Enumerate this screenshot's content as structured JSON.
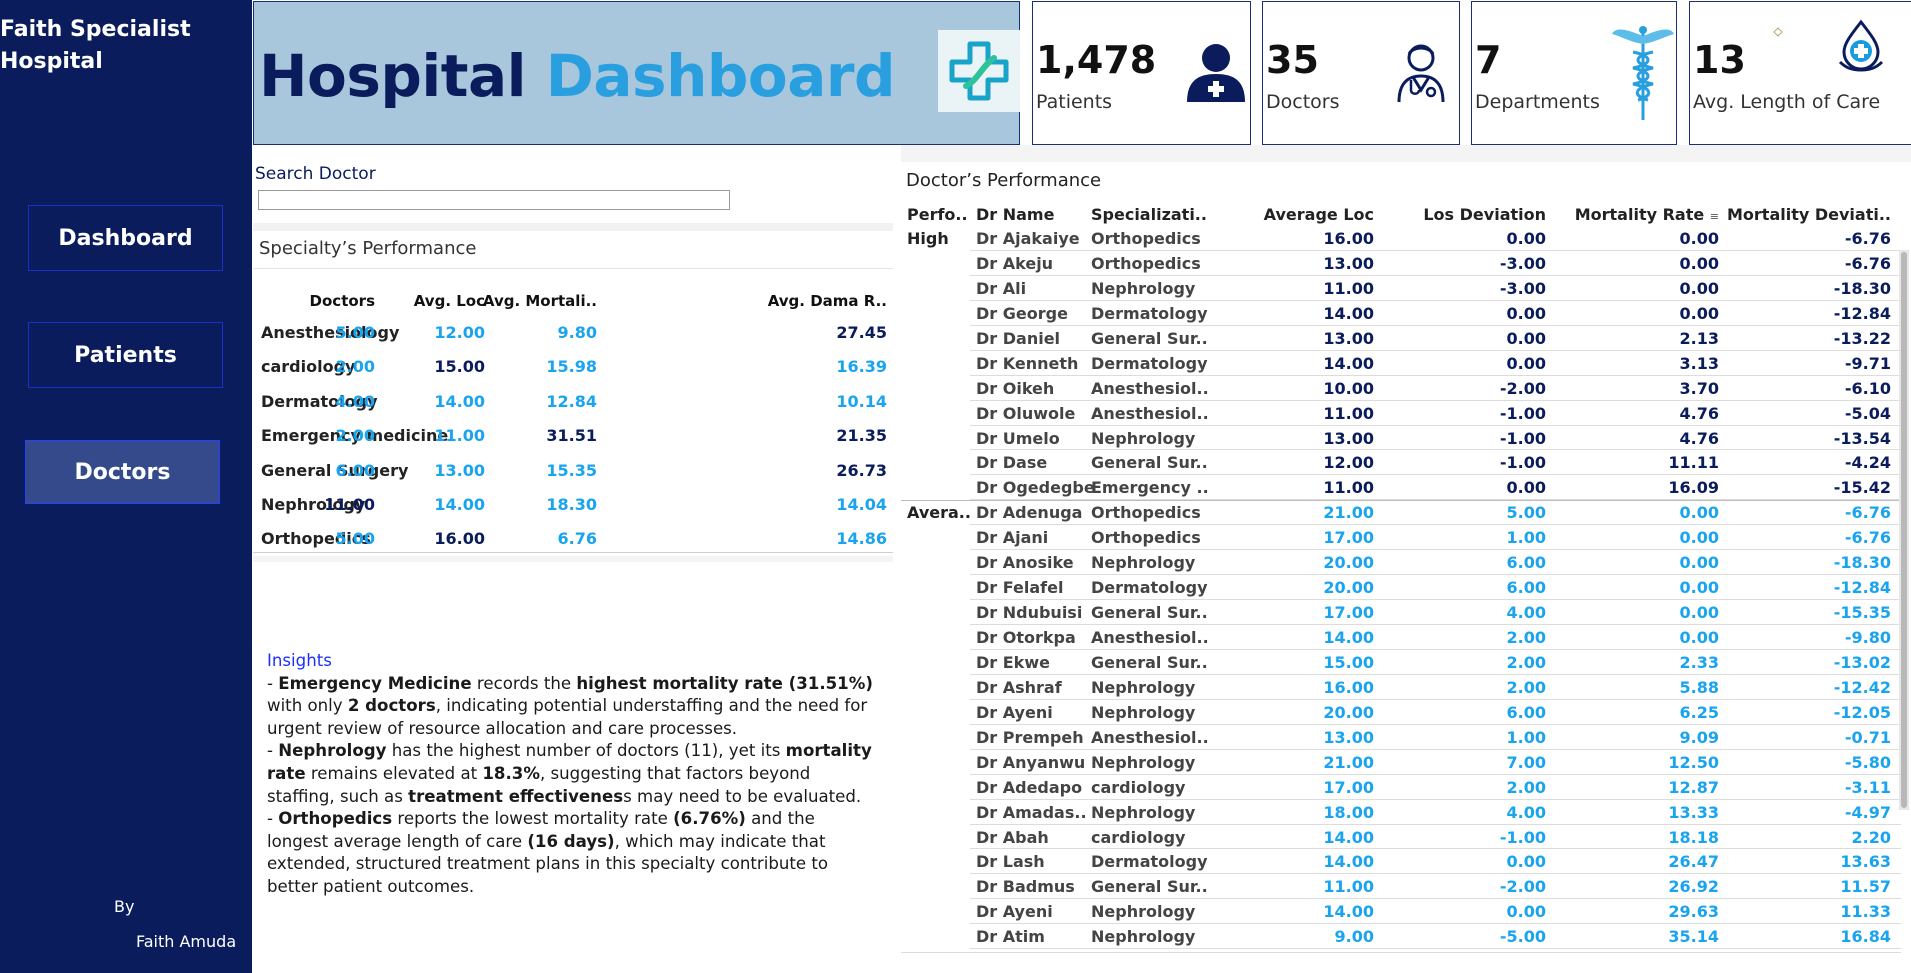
{
  "sidebar": {
    "hospital_name_line1": "Faith Specialist",
    "hospital_name_line2": "Hospital",
    "nav": {
      "dashboard": "Dashboard",
      "patients": "Patients",
      "doctors": "Doctors"
    },
    "by_label": "By",
    "author": "Faith Amuda"
  },
  "header": {
    "title_word1": "Hospital",
    "title_word2": "Dashboard"
  },
  "kpis": {
    "patients": {
      "value": "1,478",
      "label": "Patients"
    },
    "doctors": {
      "value": "35",
      "label": "Doctors"
    },
    "departments": {
      "value": "7",
      "label": "Departments"
    },
    "avg_care": {
      "value": "13",
      "label": "Avg. Length of Care"
    }
  },
  "search": {
    "label": "Search Doctor",
    "value": ""
  },
  "specialty": {
    "title": "Specialty’s Performance",
    "headers": {
      "doctors": "Doctors",
      "avg_loc": "Avg. Loc",
      "avg_mort": "Avg. Mortali..",
      "avg_dama": "Avg. Dama R.."
    },
    "rows": [
      {
        "name": "Anesthesiology",
        "doctors": "5.00",
        "avg_loc": "12.00",
        "avg_mort": "9.80",
        "avg_dama": "27.45"
      },
      {
        "name": "cardiology",
        "doctors": "2.00",
        "avg_loc": "15.00",
        "avg_mort": "15.98",
        "avg_dama": "16.39"
      },
      {
        "name": "Dermatology",
        "doctors": "4.00",
        "avg_loc": "14.00",
        "avg_mort": "12.84",
        "avg_dama": "10.14"
      },
      {
        "name": "Emergency medicine",
        "doctors": "2.00",
        "avg_loc": "11.00",
        "avg_mort": "31.51",
        "avg_dama": "21.35"
      },
      {
        "name": "General Surgery",
        "doctors": "6.00",
        "avg_loc": "13.00",
        "avg_mort": "15.35",
        "avg_dama": "26.73"
      },
      {
        "name": "Nephrology",
        "doctors": "11.00",
        "avg_loc": "14.00",
        "avg_mort": "18.30",
        "avg_dama": "14.04"
      },
      {
        "name": "Orthopedics",
        "doctors": "5.00",
        "avg_loc": "16.00",
        "avg_mort": "6.76",
        "avg_dama": "14.86"
      }
    ]
  },
  "insights": {
    "title": "Insights",
    "p1": [
      "- ",
      "Emergency Medicine",
      " records the ",
      "highest mortality rate (31.51%)",
      " with only ",
      "2 doctors",
      ", indicating potential understaffing and the need for urgent review of resource allocation and care processes."
    ],
    "p2": [
      "- ",
      "Nephrology",
      " has the highest number of doctors (11), yet its ",
      "mortality rate",
      " remains elevated at ",
      "18.3%",
      ", suggesting that factors beyond staffing, such as ",
      "treatment effectivenes",
      "s may need to be evaluated."
    ],
    "p3": [
      "- ",
      "Orthopedics",
      " reports the lowest mortality rate ",
      "(6.76%)",
      " and the longest average length of care ",
      "(16 days)",
      ", which may indicate that extended, structured treatment plans in this specialty contribute to better patient outcomes."
    ]
  },
  "doctors_table": {
    "title": "Doctor’s Performance",
    "headers": {
      "perf": "Perfo..",
      "name": "Dr Name",
      "spec": "Specializati..",
      "loc": "Average Loc",
      "dev": "Los Deviation",
      "mort": "Mortality Rate",
      "mdev": "Mortality Deviati.."
    },
    "groups": [
      {
        "label": "High",
        "rows": [
          {
            "name": "Dr Ajakaiye",
            "spec": "Orthopedics",
            "loc": "16.00",
            "dev": "0.00",
            "mort": "0.00",
            "mdev": "-6.76"
          },
          {
            "name": "Dr Akeju",
            "spec": "Orthopedics",
            "loc": "13.00",
            "dev": "-3.00",
            "mort": "0.00",
            "mdev": "-6.76"
          },
          {
            "name": "Dr Ali",
            "spec": "Nephrology",
            "loc": "11.00",
            "dev": "-3.00",
            "mort": "0.00",
            "mdev": "-18.30"
          },
          {
            "name": "Dr George",
            "spec": "Dermatology",
            "loc": "14.00",
            "dev": "0.00",
            "mort": "0.00",
            "mdev": "-12.84"
          },
          {
            "name": " Dr Daniel",
            "spec": "General Sur..",
            "loc": "13.00",
            "dev": "0.00",
            "mort": "2.13",
            "mdev": "-13.22"
          },
          {
            "name": "Dr Kenneth",
            "spec": "Dermatology",
            "loc": "14.00",
            "dev": "0.00",
            "mort": "3.13",
            "mdev": "-9.71"
          },
          {
            "name": "Dr Oikeh",
            "spec": "Anesthesiol..",
            "loc": "10.00",
            "dev": "-2.00",
            "mort": "3.70",
            "mdev": "-6.10"
          },
          {
            "name": "Dr Oluwole",
            "spec": "Anesthesiol..",
            "loc": "11.00",
            "dev": "-1.00",
            "mort": "4.76",
            "mdev": "-5.04"
          },
          {
            "name": "Dr Umelo",
            "spec": "Nephrology",
            "loc": "13.00",
            "dev": "-1.00",
            "mort": "4.76",
            "mdev": "-13.54"
          },
          {
            "name": "Dr Dase",
            "spec": "General Sur..",
            "loc": "12.00",
            "dev": "-1.00",
            "mort": "11.11",
            "mdev": "-4.24"
          },
          {
            "name": "Dr Ogedegbe",
            "spec": "Emergency ..",
            "loc": "11.00",
            "dev": "0.00",
            "mort": "16.09",
            "mdev": "-15.42"
          }
        ]
      },
      {
        "label": "Avera..",
        "rows": [
          {
            "name": "Dr Adenuga",
            "spec": "Orthopedics",
            "loc": "21.00",
            "dev": "5.00",
            "mort": "0.00",
            "mdev": "-6.76"
          },
          {
            "name": "Dr Ajani",
            "spec": "Orthopedics",
            "loc": "17.00",
            "dev": "1.00",
            "mort": "0.00",
            "mdev": "-6.76"
          },
          {
            "name": "Dr Anosike",
            "spec": "Nephrology",
            "loc": "20.00",
            "dev": "6.00",
            "mort": "0.00",
            "mdev": "-18.30"
          },
          {
            "name": "Dr Felafel",
            "spec": "Dermatology",
            "loc": "20.00",
            "dev": "6.00",
            "mort": "0.00",
            "mdev": "-12.84"
          },
          {
            "name": "Dr Ndubuisi",
            "spec": "General Sur..",
            "loc": "17.00",
            "dev": "4.00",
            "mort": "0.00",
            "mdev": "-15.35"
          },
          {
            "name": "Dr Otorkpa",
            "spec": "Anesthesiol..",
            "loc": "14.00",
            "dev": "2.00",
            "mort": "0.00",
            "mdev": "-9.80"
          },
          {
            "name": "Dr Ekwe",
            "spec": "General Sur..",
            "loc": "15.00",
            "dev": "2.00",
            "mort": "2.33",
            "mdev": "-13.02"
          },
          {
            "name": "Dr Ashraf",
            "spec": "Nephrology",
            "loc": "16.00",
            "dev": "2.00",
            "mort": "5.88",
            "mdev": "-12.42"
          },
          {
            "name": "Dr Ayeni",
            "spec": "Nephrology",
            "loc": "20.00",
            "dev": "6.00",
            "mort": "6.25",
            "mdev": "-12.05"
          },
          {
            "name": "Dr Prempeh",
            "spec": "Anesthesiol..",
            "loc": "13.00",
            "dev": "1.00",
            "mort": "9.09",
            "mdev": "-0.71"
          },
          {
            "name": "Dr Anyanwu",
            "spec": "Nephrology",
            "loc": "21.00",
            "dev": "7.00",
            "mort": "12.50",
            "mdev": "-5.80"
          },
          {
            "name": "Dr Adedapo",
            "spec": "cardiology",
            "loc": "17.00",
            "dev": "2.00",
            "mort": "12.87",
            "mdev": "-3.11"
          },
          {
            "name": "Dr Amadas..",
            "spec": "Nephrology",
            "loc": "18.00",
            "dev": "4.00",
            "mort": "13.33",
            "mdev": "-4.97"
          },
          {
            "name": "Dr Abah",
            "spec": "cardiology",
            "loc": "14.00",
            "dev": "-1.00",
            "mort": "18.18",
            "mdev": "2.20"
          },
          {
            "name": "Dr Lash",
            "spec": "Dermatology",
            "loc": "14.00",
            "dev": "0.00",
            "mort": "26.47",
            "mdev": "13.63"
          },
          {
            "name": "Dr Badmus",
            "spec": "General Sur..",
            "loc": "11.00",
            "dev": "-2.00",
            "mort": "26.92",
            "mdev": "11.57"
          },
          {
            "name": "Dr Ayeni",
            "spec": "Nephrology",
            "loc": "14.00",
            "dev": "0.00",
            "mort": "29.63",
            "mdev": "11.33"
          },
          {
            "name": "Dr Atim",
            "spec": "Nephrology",
            "loc": "9.00",
            "dev": "-5.00",
            "mort": "35.14",
            "mdev": "16.84"
          }
        ]
      }
    ]
  },
  "colors": {
    "navy": "#0a1c5c",
    "light_blue": "#1aa4f0",
    "header_bg": "#a8c7dc",
    "active_nav": "#354a8a"
  }
}
